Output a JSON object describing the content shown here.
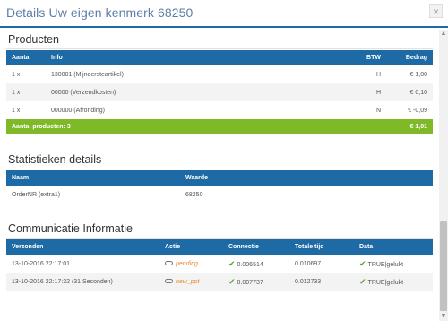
{
  "header": {
    "title": "Details Uw eigen kenmerk 68250",
    "close_glyph": "×"
  },
  "products": {
    "title": "Producten",
    "columns": [
      "Aantal",
      "Info",
      "BTW",
      "Bedrag"
    ],
    "rows": [
      {
        "aantal": "1 x",
        "info": "130001 (Mijneersteartikel)",
        "btw": "H",
        "bedrag": "€ 1,00"
      },
      {
        "aantal": "1 x",
        "info": "00000 (Verzendkosten)",
        "btw": "H",
        "bedrag": "€ 0,10"
      },
      {
        "aantal": "1 x",
        "info": "000000 (Afronding)",
        "btw": "N",
        "bedrag": "€ -0,09"
      }
    ],
    "footer_label": "Aantal producten: 3",
    "footer_total": "€ 1,01"
  },
  "stats": {
    "title": "Statistieken details",
    "columns": [
      "Naam",
      "Waarde"
    ],
    "rows": [
      {
        "naam": "OrderNR (extra1)",
        "waarde": "68250"
      }
    ]
  },
  "comm": {
    "title": "Communicatie Informatie",
    "columns": [
      "Verzonden",
      "Actie",
      "Connectie",
      "Totale tijd",
      "Data"
    ],
    "rows": [
      {
        "verzonden": "13-10-2016 22:17:01",
        "actie": "pending",
        "connectie": "0.006514",
        "totale_tijd": "0.010697",
        "data": "TRUE|gelukt"
      },
      {
        "verzonden": "13-10-2016 22:17:32 (31 Seconden)",
        "actie": "new_ppt",
        "connectie": "0.007737",
        "totale_tijd": "0.012733",
        "data": "TRUE|gelukt"
      }
    ]
  },
  "icons": {
    "link": "link-icon",
    "check": "check-icon"
  },
  "colors": {
    "header_blue": "#1d6aa5",
    "footer_green": "#7fb927",
    "action_orange": "#e8872e",
    "check_green": "#5aa02c",
    "title_blue": "#5b7fa6"
  }
}
